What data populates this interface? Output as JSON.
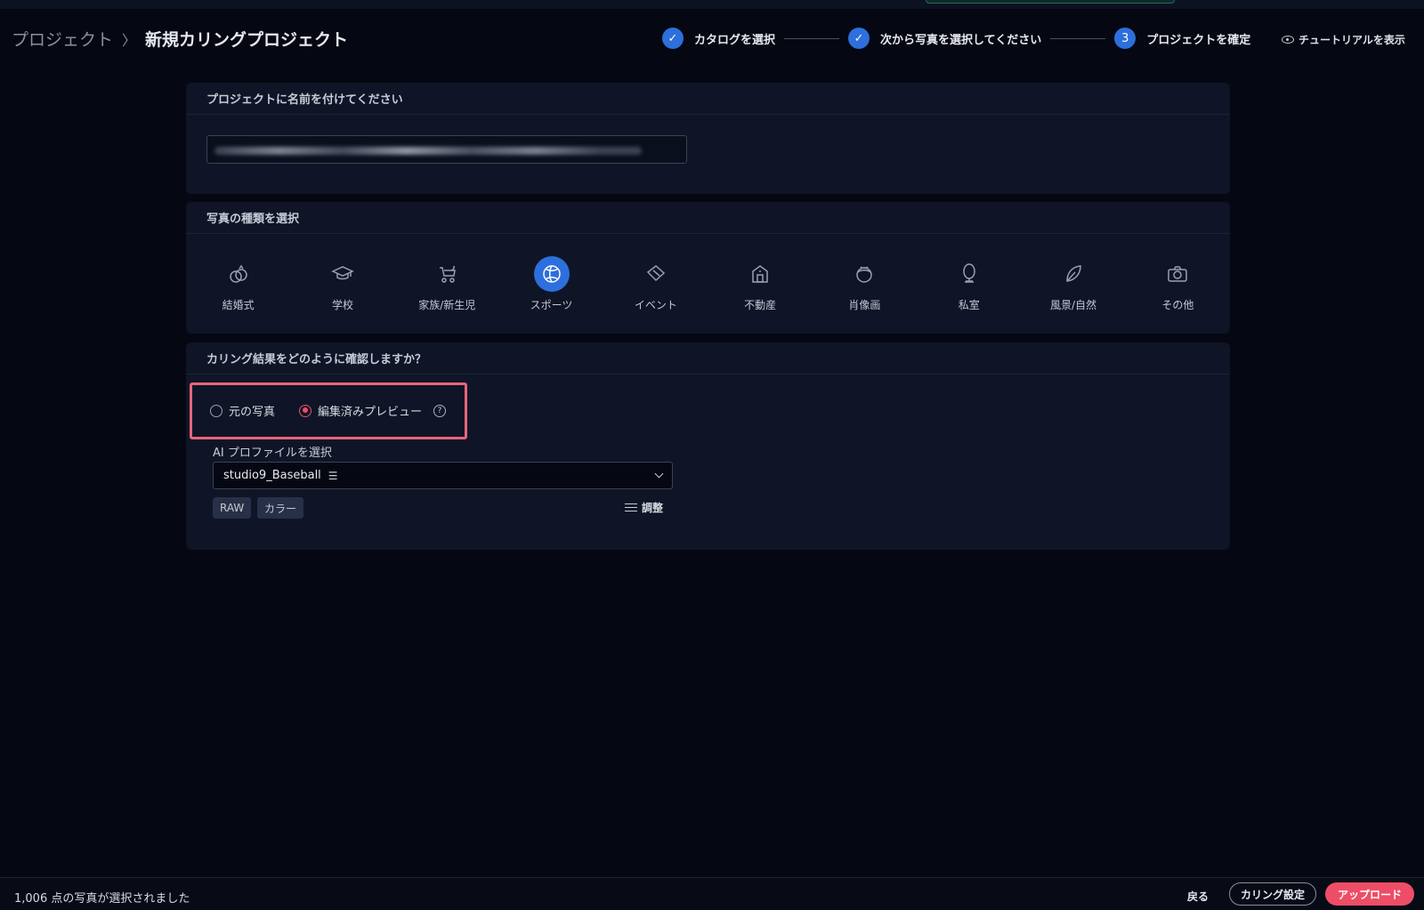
{
  "breadcrumb": {
    "parent": "プロジェクト",
    "separator": "〉",
    "current": "新規カリングプロジェクト"
  },
  "stepper": {
    "steps": [
      {
        "label": "カタログを選択",
        "status": "done",
        "marker": "✓"
      },
      {
        "label": "次から写真を選択してください",
        "status": "done",
        "marker": "✓"
      },
      {
        "label": "プロジェクトを確定",
        "status": "current",
        "marker": "3"
      }
    ],
    "tutorial_label": "チュートリアルを表示"
  },
  "name_section": {
    "title": "プロジェクトに名前を付けてください",
    "value_blurred": true
  },
  "type_section": {
    "title": "写真の種類を選択",
    "types": [
      {
        "label": "結婚式",
        "icon": "rings-icon"
      },
      {
        "label": "学校",
        "icon": "graduation-cap-icon"
      },
      {
        "label": "家族/新生児",
        "icon": "stroller-icon"
      },
      {
        "label": "スポーツ",
        "icon": "ball-icon",
        "selected": true
      },
      {
        "label": "イベント",
        "icon": "ticket-icon"
      },
      {
        "label": "不動産",
        "icon": "house-icon"
      },
      {
        "label": "肖像画",
        "icon": "portrait-icon"
      },
      {
        "label": "私室",
        "icon": "mirror-icon"
      },
      {
        "label": "風景/自然",
        "icon": "leaf-icon"
      },
      {
        "label": "その他",
        "icon": "camera-icon"
      }
    ]
  },
  "review_section": {
    "title": "カリング結果をどのように確認しますか？",
    "options": [
      {
        "label": "元の写真",
        "checked": false
      },
      {
        "label": "編集済みプレビュー",
        "checked": true
      }
    ],
    "ai_profile_label": "AI プロファイルを選択",
    "selected_profile": "studio9_Baseball",
    "tags": [
      "RAW",
      "カラー"
    ],
    "adjust_label": "調整"
  },
  "footer": {
    "status": "1,006 点の写真が選択されました",
    "back_label": "戻る",
    "settings_label": "カリング設定",
    "upload_label": "アップロード"
  },
  "colors": {
    "accent_blue": "#2d6fdc",
    "accent_red": "#ee4d67",
    "background": "#050813",
    "card": "#0f1527"
  }
}
